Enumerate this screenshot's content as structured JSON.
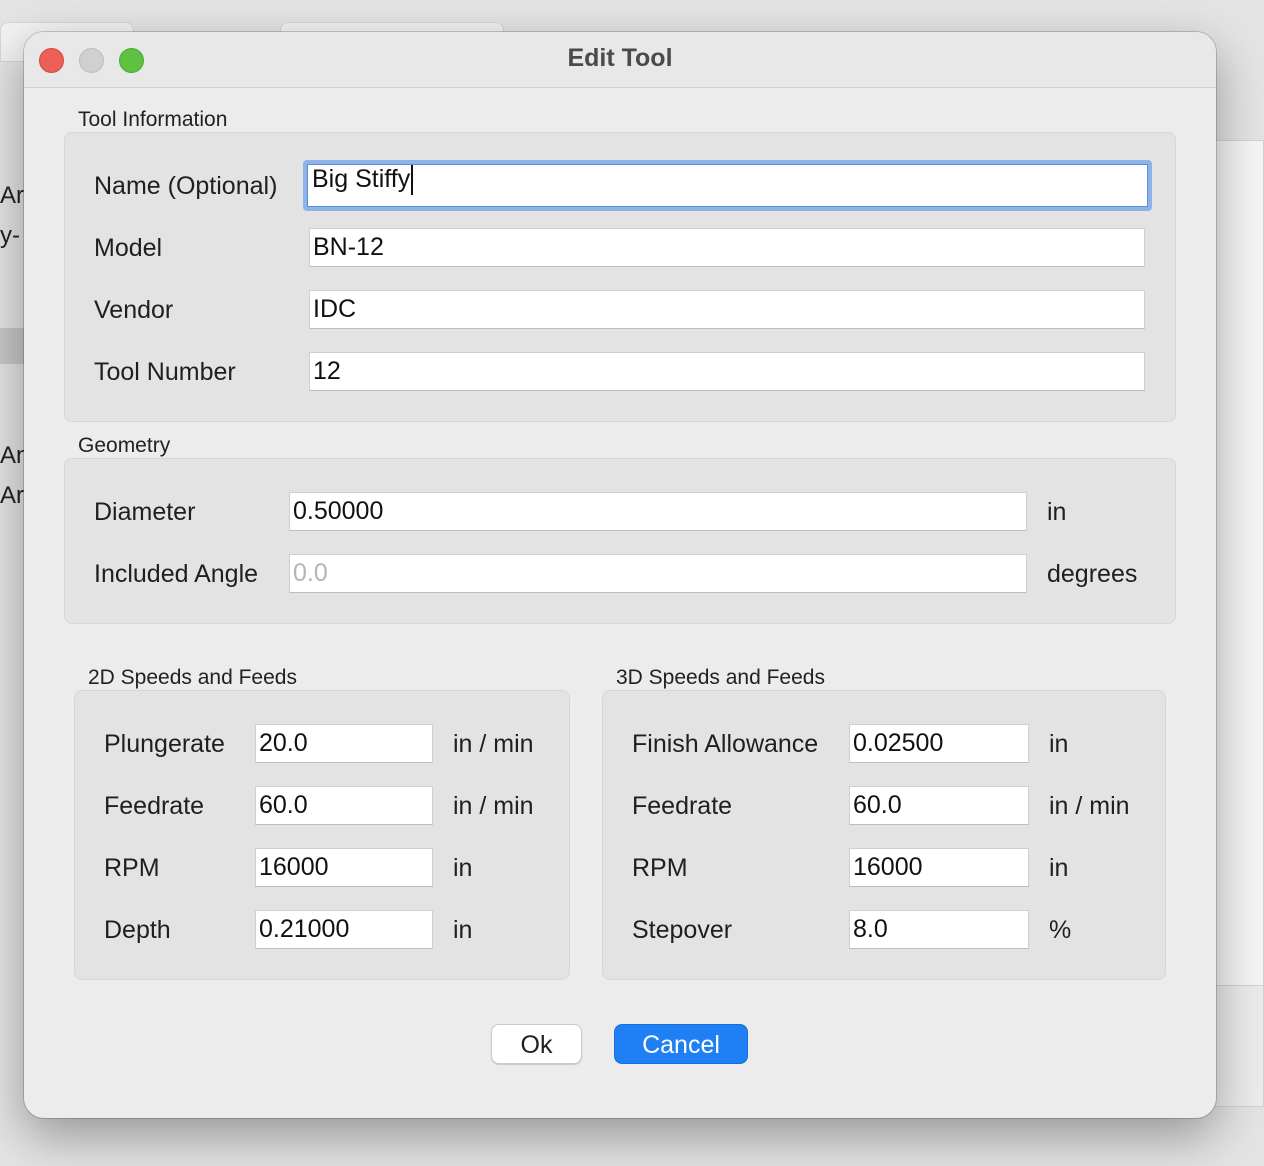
{
  "background": {
    "text_lines": [
      "Ar",
      "y-",
      "An",
      "Ar"
    ]
  },
  "dialog": {
    "title": "Edit Tool",
    "tool_information": {
      "group_label": "Tool Information",
      "name_label": "Name (Optional)",
      "name_value": "Big Stiffy",
      "model_label": "Model",
      "model_value": "BN-12",
      "vendor_label": "Vendor",
      "vendor_value": "IDC",
      "tool_number_label": "Tool Number",
      "tool_number_value": "12"
    },
    "geometry": {
      "group_label": "Geometry",
      "diameter_label": "Diameter",
      "diameter_value": "0.50000",
      "diameter_unit": "in",
      "angle_label": "Included Angle",
      "angle_placeholder": "0.0",
      "angle_unit": "degrees"
    },
    "speeds_2d": {
      "group_label": "2D Speeds and Feeds",
      "plungerate_label": "Plungerate",
      "plungerate_value": "20.0",
      "plungerate_unit": "in / min",
      "feedrate_label": "Feedrate",
      "feedrate_value": "60.0",
      "feedrate_unit": "in / min",
      "rpm_label": "RPM",
      "rpm_value": "16000",
      "rpm_unit": "in",
      "depth_label": "Depth",
      "depth_value": "0.21000",
      "depth_unit": "in"
    },
    "speeds_3d": {
      "group_label": "3D Speeds and Feeds",
      "finish_label": "Finish Allowance",
      "finish_value": "0.02500",
      "finish_unit": "in",
      "feedrate_label": "Feedrate",
      "feedrate_value": "60.0",
      "feedrate_unit": "in / min",
      "rpm_label": "RPM",
      "rpm_value": "16000",
      "rpm_unit": "in",
      "stepover_label": "Stepover",
      "stepover_value": "8.0",
      "stepover_unit": "%"
    },
    "buttons": {
      "ok_label": "Ok",
      "cancel_label": "Cancel"
    }
  }
}
